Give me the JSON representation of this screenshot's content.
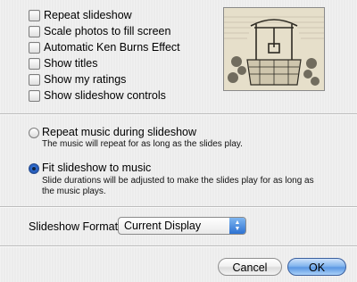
{
  "checkboxes": [
    {
      "label": "Repeat slideshow",
      "checked": false
    },
    {
      "label": "Scale photos to fill screen",
      "checked": false
    },
    {
      "label": "Automatic Ken Burns Effect",
      "checked": false
    },
    {
      "label": "Show titles",
      "checked": false
    },
    {
      "label": "Show my ratings",
      "checked": false
    },
    {
      "label": "Show slideshow controls",
      "checked": false
    }
  ],
  "music_options": {
    "repeat": {
      "label": "Repeat music during slideshow",
      "description": "The music will repeat for as long as the slides play.",
      "selected": false
    },
    "fit": {
      "label": "Fit slideshow to music",
      "description_line1": "Slide durations will be adjusted to make the slides play for as long as",
      "description_line2": "the music plays.",
      "selected": true
    }
  },
  "format": {
    "label": "Slideshow Format:",
    "value": "Current Display"
  },
  "buttons": {
    "cancel": "Cancel",
    "ok": "OK"
  },
  "colors": {
    "window_bg": "#ececec",
    "default_button": "#5b98e3"
  }
}
